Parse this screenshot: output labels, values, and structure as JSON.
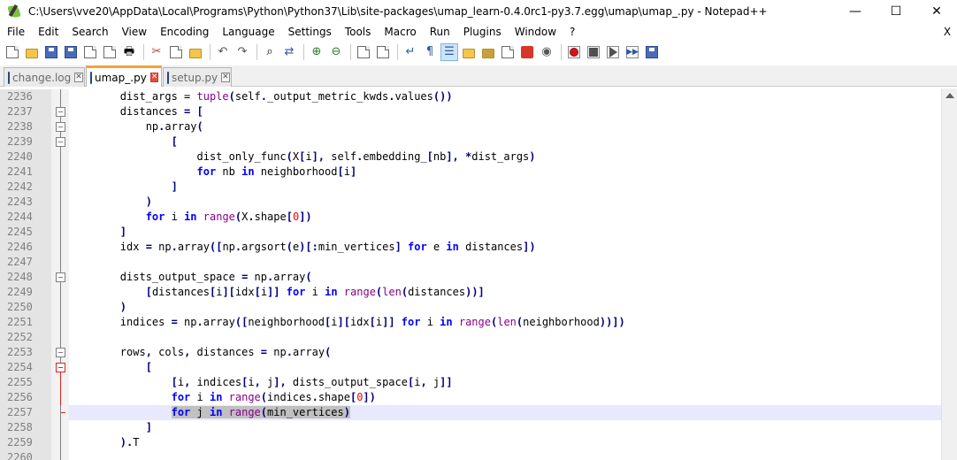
{
  "window": {
    "title": "C:\\Users\\vve20\\AppData\\Local\\Programs\\Python\\Python37\\Lib\\site-packages\\umap_learn-0.4.0rc1-py3.7.egg\\umap\\umap_.py - Notepad++",
    "minimize": "—",
    "maximize": "☐",
    "close": "✕"
  },
  "menu": {
    "items": [
      "File",
      "Edit",
      "Search",
      "View",
      "Encoding",
      "Language",
      "Settings",
      "Tools",
      "Macro",
      "Run",
      "Plugins",
      "Window",
      "?"
    ],
    "close": "X"
  },
  "tabs": [
    {
      "label": "change.log",
      "active": false
    },
    {
      "label": "umap_.py",
      "active": true
    },
    {
      "label": "setup.py",
      "active": false
    }
  ],
  "editor": {
    "lines": [
      {
        "num": "2236",
        "fold": "vline",
        "html": "        dist_args = <span class=\"bi\">tuple</span><span class=\"op\">(</span>self<span class=\"op\">.</span>_output_metric_kwds<span class=\"op\">.</span>values<span class=\"op\">())</span>"
      },
      {
        "num": "2237",
        "fold": "box",
        "html": "        distances <span class=\"op\">=</span> <span class=\"op\">[</span>"
      },
      {
        "num": "2238",
        "fold": "box",
        "html": "            np<span class=\"op\">.</span>array<span class=\"op\">(</span>"
      },
      {
        "num": "2239",
        "fold": "box",
        "html": "                <span class=\"op\">[</span>"
      },
      {
        "num": "2240",
        "fold": "vline",
        "html": "                    dist_only_func<span class=\"op\">(</span>X<span class=\"op\">[</span>i<span class=\"op\">],</span> self<span class=\"op\">.</span>embedding_<span class=\"op\">[</span>nb<span class=\"op\">],</span> <span class=\"op\">*</span>dist_args<span class=\"op\">)</span>"
      },
      {
        "num": "2241",
        "fold": "vline",
        "html": "                    <span class=\"kw\">for</span> nb <span class=\"kw\">in</span> neighborhood<span class=\"op\">[</span>i<span class=\"op\">]</span>"
      },
      {
        "num": "2242",
        "fold": "vline",
        "html": "                <span class=\"op\">]</span>"
      },
      {
        "num": "2243",
        "fold": "vline",
        "html": "            <span class=\"op\">)</span>"
      },
      {
        "num": "2244",
        "fold": "vline",
        "html": "            <span class=\"kw\">for</span> i <span class=\"kw\">in</span> <span class=\"bi\">range</span><span class=\"op\">(</span>X<span class=\"op\">.</span>shape<span class=\"op\">[</span><span class=\"num\">0</span><span class=\"op\">])</span>"
      },
      {
        "num": "2245",
        "fold": "vline",
        "html": "        <span class=\"op\">]</span>"
      },
      {
        "num": "2246",
        "fold": "vline",
        "html": "        idx <span class=\"op\">=</span> np<span class=\"op\">.</span>array<span class=\"op\">([</span>np<span class=\"op\">.</span>argsort<span class=\"op\">(</span>e<span class=\"op\">)[:</span>min_vertices<span class=\"op\">]</span> <span class=\"kw\">for</span> e <span class=\"kw\">in</span> distances<span class=\"op\">])</span>"
      },
      {
        "num": "2247",
        "fold": "vline",
        "html": ""
      },
      {
        "num": "2248",
        "fold": "box",
        "html": "        dists_output_space <span class=\"op\">=</span> np<span class=\"op\">.</span>array<span class=\"op\">(</span>"
      },
      {
        "num": "2249",
        "fold": "vline",
        "html": "            <span class=\"op\">[</span>distances<span class=\"op\">[</span>i<span class=\"op\">][</span>idx<span class=\"op\">[</span>i<span class=\"op\">]]</span> <span class=\"kw\">for</span> i <span class=\"kw\">in</span> <span class=\"bi\">range</span><span class=\"op\">(</span><span class=\"bi\">len</span><span class=\"op\">(</span>distances<span class=\"op\">))]</span>"
      },
      {
        "num": "2250",
        "fold": "vline",
        "html": "        <span class=\"op\">)</span>"
      },
      {
        "num": "2251",
        "fold": "vline",
        "html": "        indices <span class=\"op\">=</span> np<span class=\"op\">.</span>array<span class=\"op\">([</span>neighborhood<span class=\"op\">[</span>i<span class=\"op\">][</span>idx<span class=\"op\">[</span>i<span class=\"op\">]]</span> <span class=\"kw\">for</span> i <span class=\"kw\">in</span> <span class=\"bi\">range</span><span class=\"op\">(</span><span class=\"bi\">len</span><span class=\"op\">(</span>neighborhood<span class=\"op\">))])</span>"
      },
      {
        "num": "2252",
        "fold": "vline",
        "html": ""
      },
      {
        "num": "2253",
        "fold": "box",
        "html": "        rows<span class=\"op\">,</span> cols<span class=\"op\">,</span> distances <span class=\"op\">=</span> np<span class=\"op\">.</span>array<span class=\"op\">(</span>"
      },
      {
        "num": "2254",
        "fold": "boxred",
        "html": "            <span class=\"op\">[</span>"
      },
      {
        "num": "2255",
        "fold": "vlinered",
        "html": "                <span class=\"op\">[</span>i<span class=\"op\">,</span> indices<span class=\"op\">[</span>i<span class=\"op\">,</span> j<span class=\"op\">],</span> dists_output_space<span class=\"op\">[</span>i<span class=\"op\">,</span> j<span class=\"op\">]]</span>"
      },
      {
        "num": "2256",
        "fold": "vlinered",
        "html": "                <span class=\"kw\">for</span> i <span class=\"kw\">in</span> <span class=\"bi\">range</span><span class=\"op\">(</span>indices<span class=\"op\">.</span>shape<span class=\"op\">[</span><span class=\"num\">0</span><span class=\"op\">])</span>"
      },
      {
        "num": "2257",
        "fold": "endred",
        "current": true,
        "html": "                <span class=\"sel\"><span class=\"kw\">for</span> j <span class=\"kw\">in</span> <span class=\"bi\">range</span><span class=\"op\">(</span>min_vertices<span class=\"op\">)</span></span>"
      },
      {
        "num": "2258",
        "fold": "vline",
        "html": "            <span class=\"op\">]</span>"
      },
      {
        "num": "2259",
        "fold": "vline",
        "html": "        <span class=\"op\">).</span>T"
      },
      {
        "num": "2260",
        "fold": "vline",
        "html": ""
      }
    ]
  },
  "colors": {
    "keyword": "#0000ff",
    "builtin": "#880088",
    "operator": "#000080",
    "number": "#ff0000",
    "current_line": "#e8e8ff",
    "selection": "#c0c0c0",
    "active_tab_accent": "#f2a33a"
  }
}
